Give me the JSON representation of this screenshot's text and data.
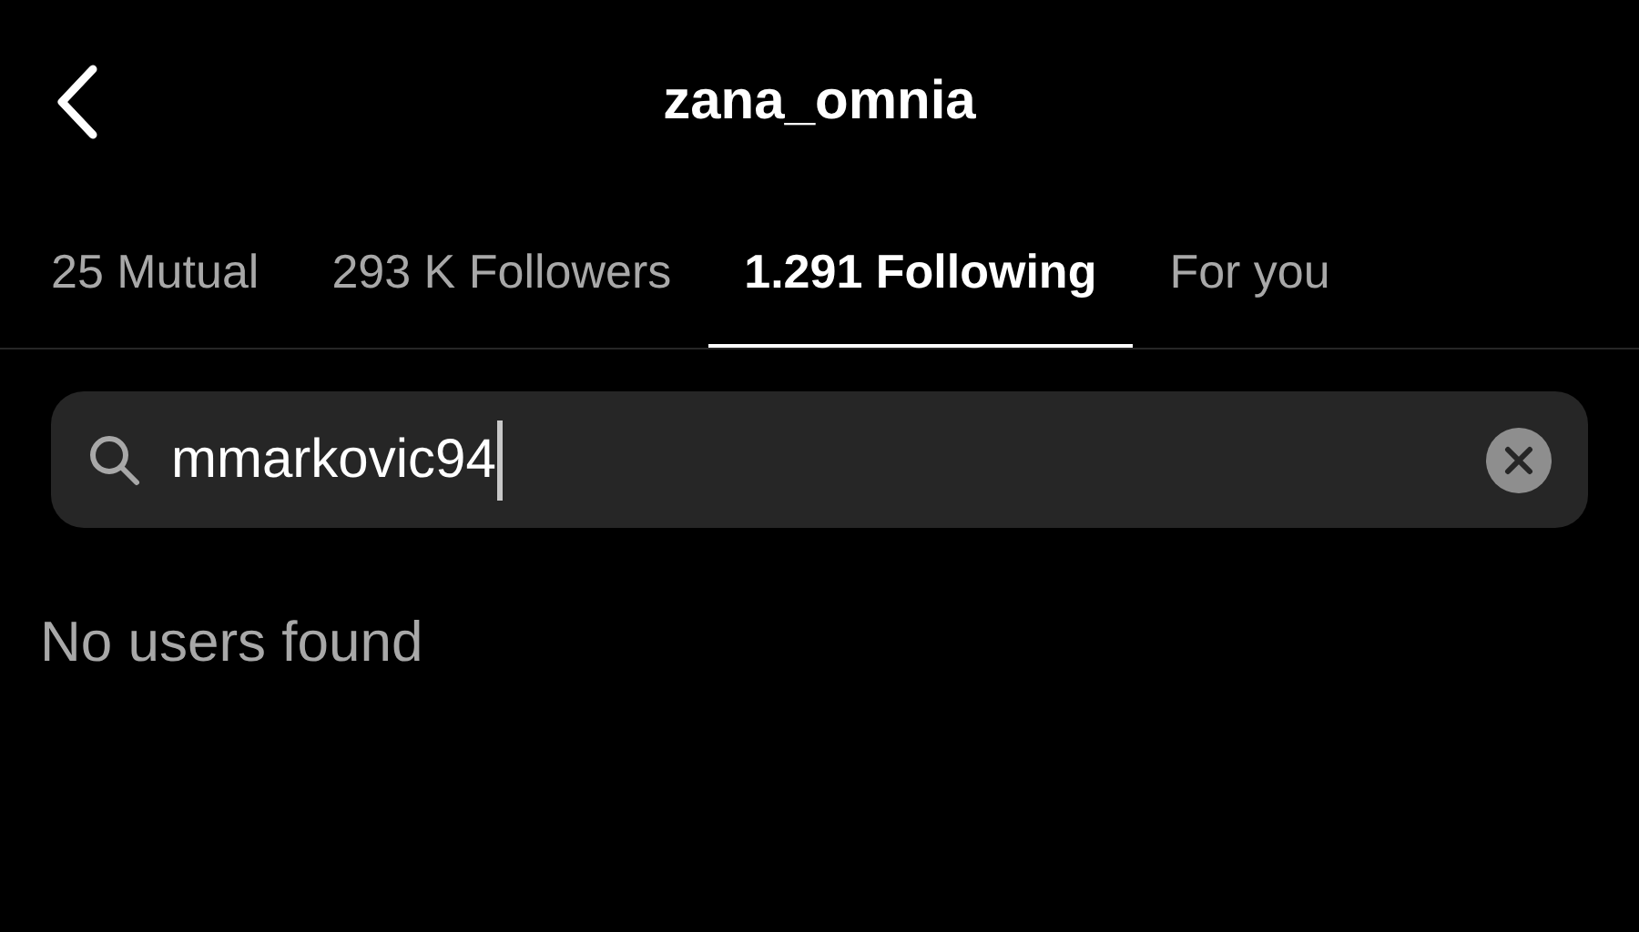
{
  "header": {
    "title": "zana_omnia"
  },
  "tabs": [
    {
      "label": "25 Mutual",
      "selected": false
    },
    {
      "label": "293 K Followers",
      "selected": false
    },
    {
      "label": "1.291 Following",
      "selected": true
    },
    {
      "label": "For you",
      "selected": false
    }
  ],
  "search": {
    "value": "mmarkovic94"
  },
  "message": "No users found"
}
